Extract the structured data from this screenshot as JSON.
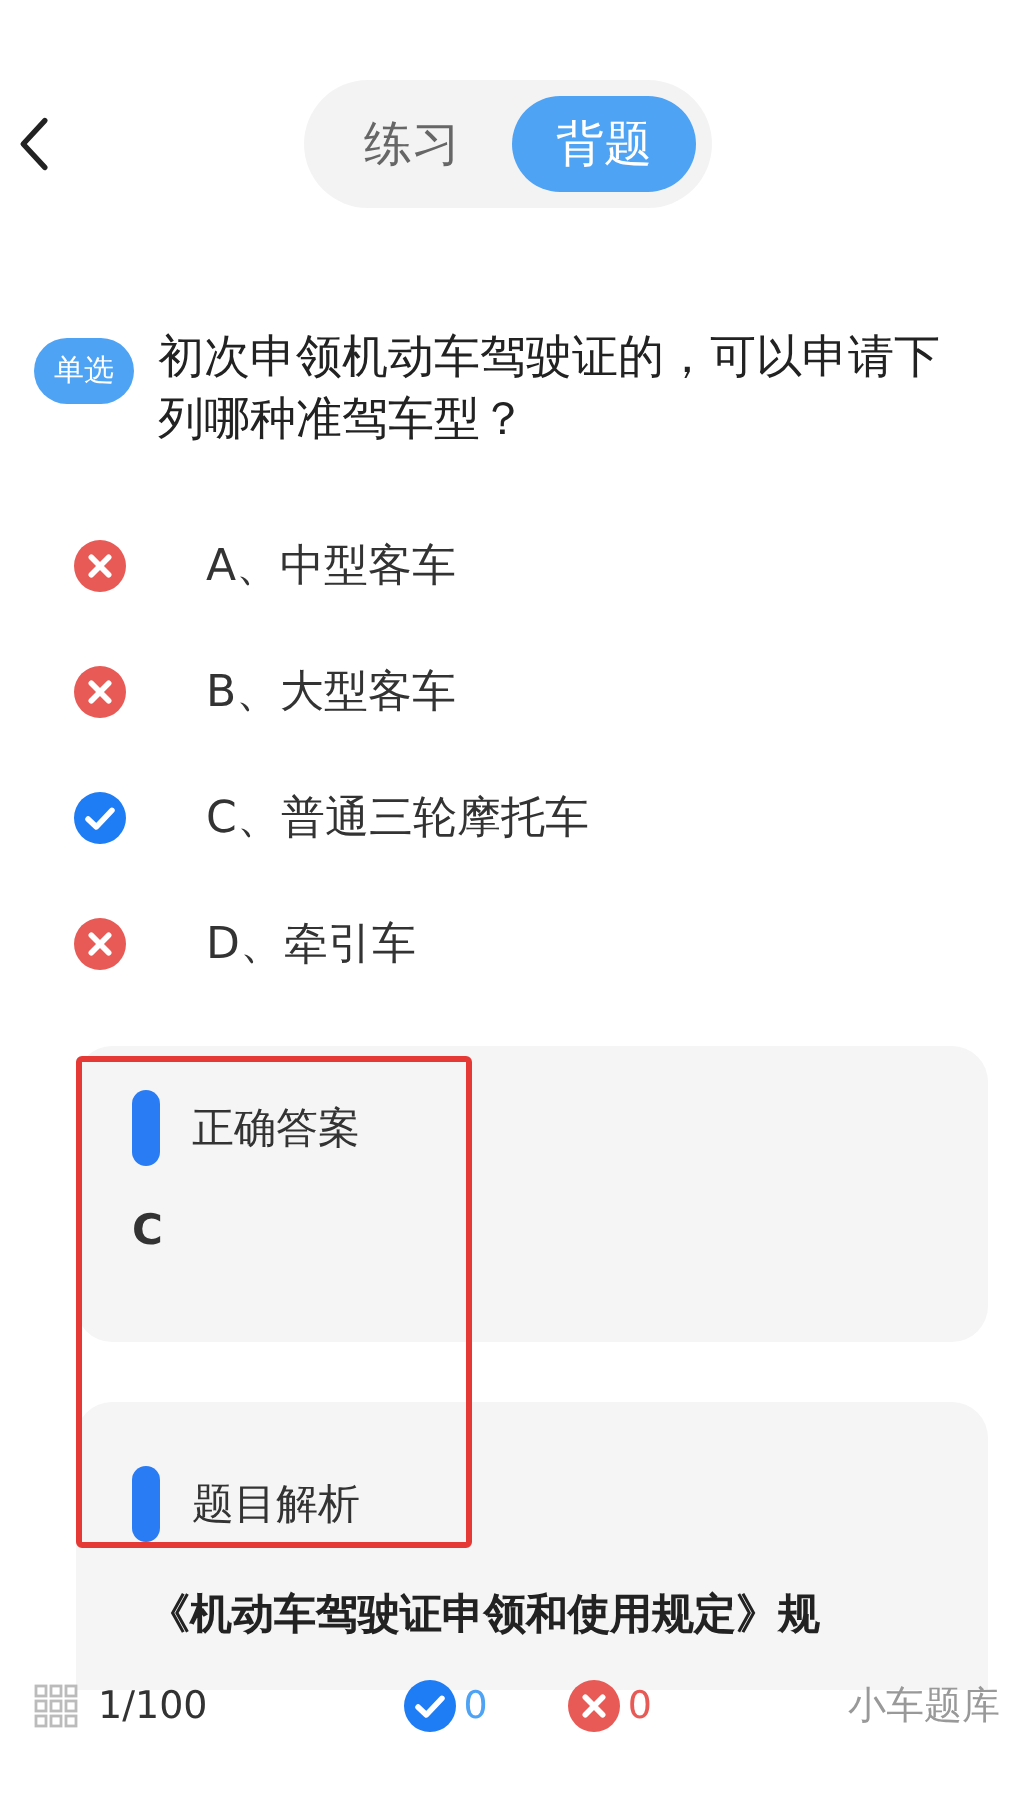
{
  "header": {
    "tabs": [
      {
        "label": "练习",
        "selected": false
      },
      {
        "label": "背题",
        "selected": true
      }
    ]
  },
  "question": {
    "type_badge": "单选",
    "text": "初次申领机动车驾驶证的，可以申请下列哪种准驾车型？",
    "options": [
      {
        "label": "A、中型客车",
        "correct": false
      },
      {
        "label": "B、大型客车",
        "correct": false
      },
      {
        "label": "C、普通三轮摩托车",
        "correct": true
      },
      {
        "label": "D、牵引车",
        "correct": false
      }
    ]
  },
  "answer_panel": {
    "title": "正确答案",
    "value": "C"
  },
  "explanation_panel": {
    "title": "题目解析",
    "text": "《机动车驾驶证申领和使用规定》规"
  },
  "highlight_box": true,
  "status_bar": {
    "progress": "1/100",
    "correct_count": "0",
    "wrong_count": "0",
    "bank": "小车题库"
  }
}
